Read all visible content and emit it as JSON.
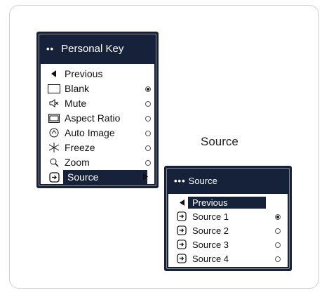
{
  "personal_key_menu": {
    "title": "Personal Key",
    "items": [
      {
        "label": "Previous",
        "icon": "left-arrow-icon",
        "radio": null
      },
      {
        "label": "Blank",
        "icon": "blank-screen-icon",
        "radio": "on"
      },
      {
        "label": "Mute",
        "icon": "mute-icon",
        "radio": "off"
      },
      {
        "label": "Aspect Ratio",
        "icon": "aspect-ratio-icon",
        "radio": "off"
      },
      {
        "label": "Auto Image",
        "icon": "auto-image-icon",
        "radio": "off"
      },
      {
        "label": "Freeze",
        "icon": "freeze-icon",
        "radio": "off"
      },
      {
        "label": "Zoom",
        "icon": "zoom-icon",
        "radio": "off"
      },
      {
        "label": "Source",
        "icon": "source-icon",
        "radio": null,
        "selected": true
      }
    ]
  },
  "caption": "Source",
  "source_menu": {
    "title": "Source",
    "items": [
      {
        "label": "Previous",
        "icon": "left-arrow-icon",
        "selected": true
      },
      {
        "label": "Source 1",
        "icon": "source-icon",
        "radio": "on"
      },
      {
        "label": "Source 2",
        "icon": "source-icon",
        "radio": "off"
      },
      {
        "label": "Source 3",
        "icon": "source-icon",
        "radio": "off"
      },
      {
        "label": "Source 4",
        "icon": "source-icon",
        "radio": "off"
      }
    ]
  }
}
